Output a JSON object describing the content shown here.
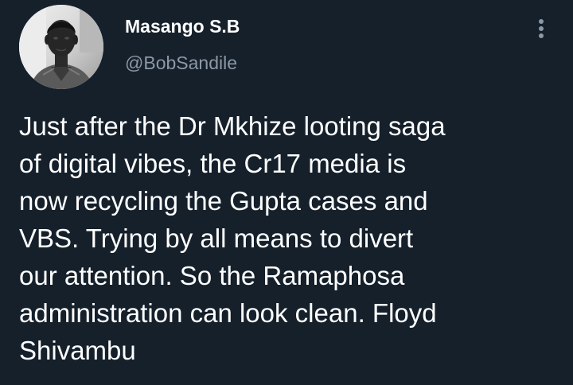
{
  "theme": {
    "background": "#15202b",
    "text_primary": "#ffffff",
    "text_secondary": "#8b98a5"
  },
  "author": {
    "display_name": "Masango S.B",
    "handle": "@BobSandile",
    "avatar_icon": "profile-photo"
  },
  "header": {
    "more_icon": "more-vertical-icon"
  },
  "tweet": {
    "lines": [
      "Just after the Dr Mkhize looting saga",
      "of digital vibes, the Cr17 media is",
      "now recycling the Gupta cases and",
      "VBS. Trying by all means to divert",
      "our attention. So the Ramaphosa",
      "administration can look clean. Floyd",
      "Shivambu"
    ]
  }
}
